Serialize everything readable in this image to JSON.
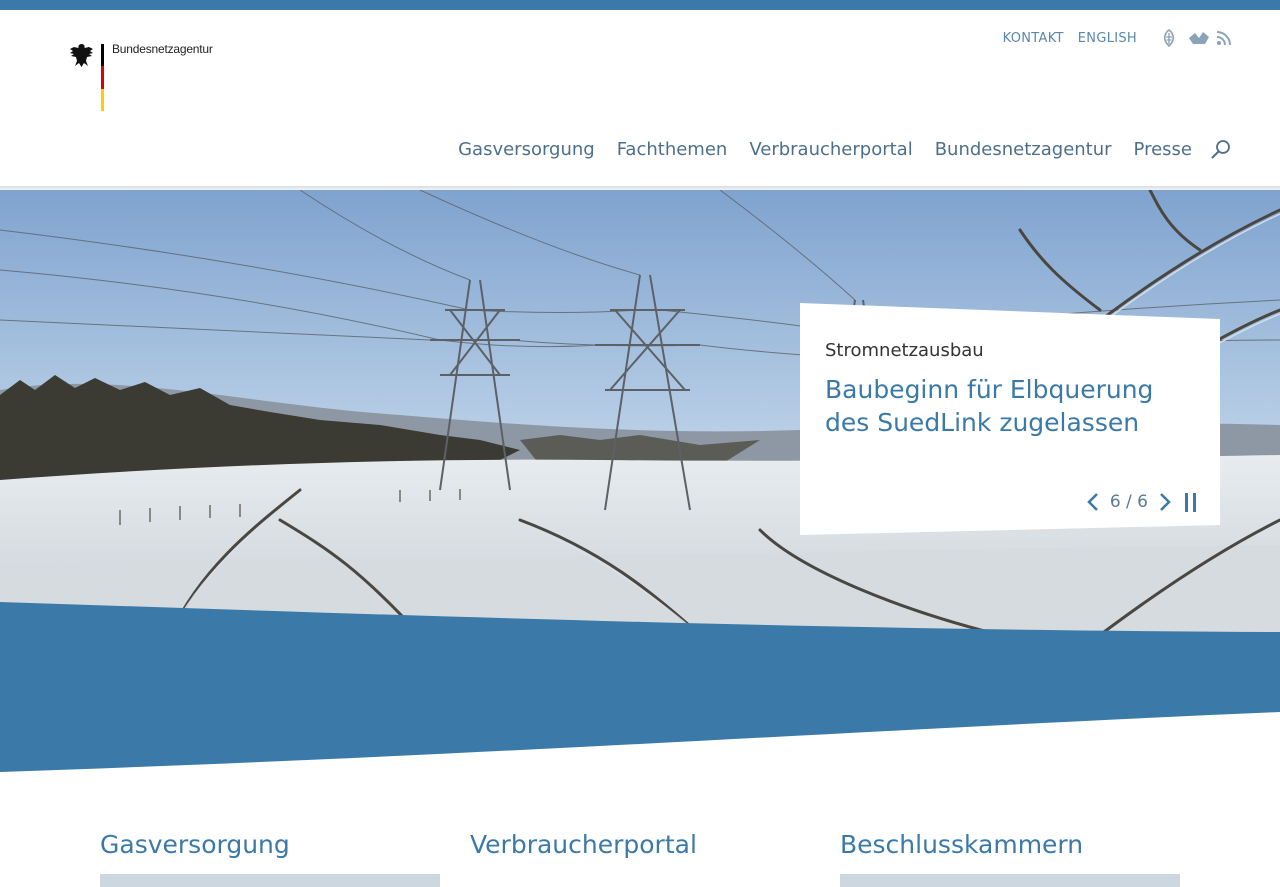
{
  "service_nav": {
    "contact": "KONTAKT",
    "english": "ENGLISH",
    "icons": [
      "easy-language-icon",
      "sign-language-icon",
      "rss-icon"
    ]
  },
  "logo": {
    "wordmark": "Bundesnetzagentur"
  },
  "main_nav": {
    "items": [
      "Gasversorgung",
      "Fachthemen",
      "Verbraucherportal",
      "Bundesnetzagentur",
      "Presse"
    ],
    "search_icon": "search-icon"
  },
  "hero": {
    "kicker": "Stromnetzausbau",
    "headline": "Baubeginn für Elbquerung des SuedLink zugelassen",
    "counter": "6 / 6"
  },
  "sections": [
    "Gasversorgung",
    "Verbraucherportal",
    "Beschlusskammern"
  ],
  "colors": {
    "accent": "#3b7aa8",
    "nav_text": "#4d6f8c"
  }
}
